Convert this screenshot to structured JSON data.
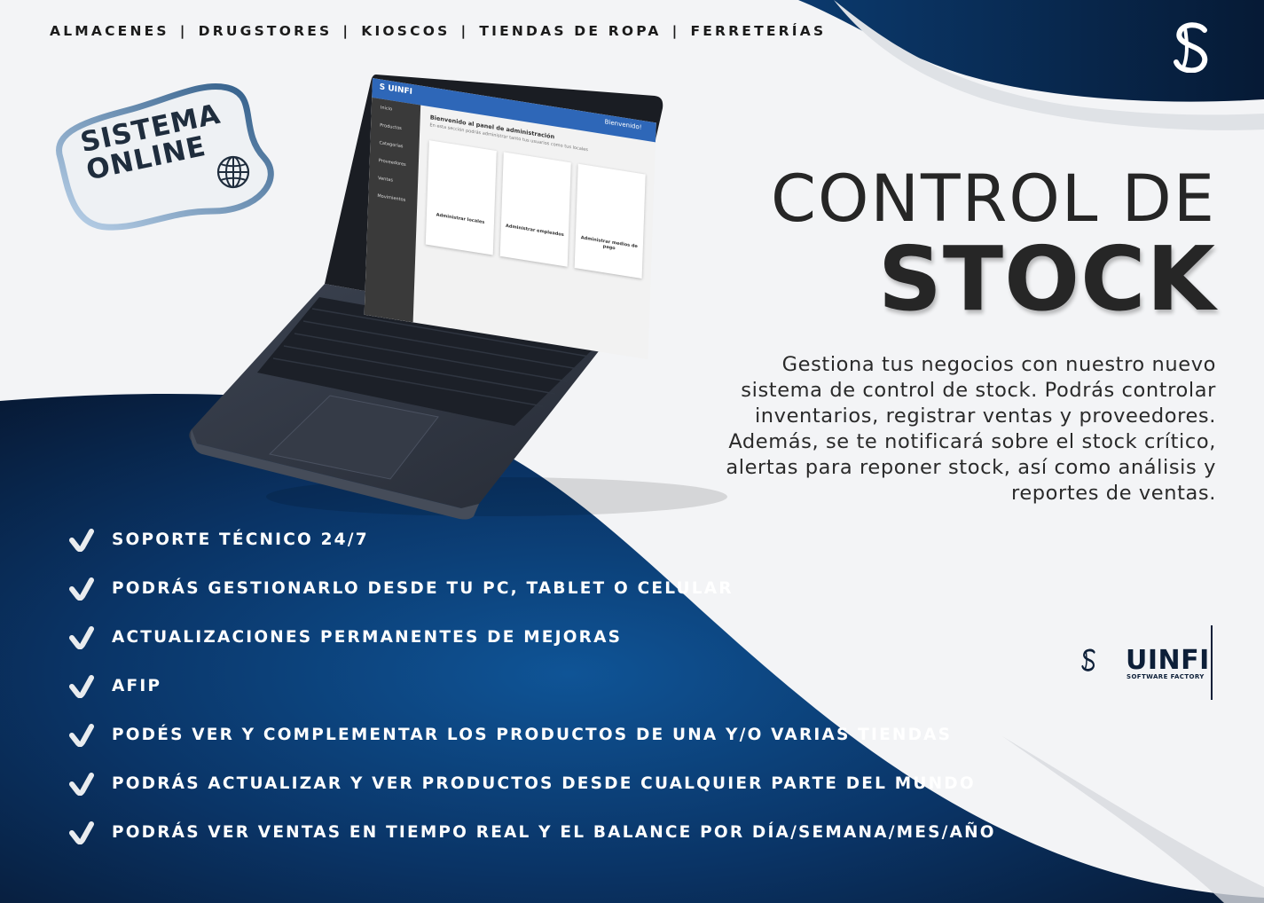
{
  "topnav": {
    "items": [
      "ALMACENES",
      "DRUGSTORES",
      "KIOSCOS",
      "TIENDAS DE ROPA",
      "FERRETERÍAS"
    ],
    "separator": "|"
  },
  "badge": {
    "line1": "SISTEMA",
    "line2": "ONLINE",
    "icon": "globe-icon"
  },
  "title": {
    "line1": "CONTROL DE",
    "line2": "STOCK"
  },
  "description": "Gestiona tus negocios con nuestro nuevo sistema de control de stock. Podrás controlar inventarios, registrar ventas y proveedores. Además, se te notificará sobre el stock crítico, alertas para reponer stock, así como análisis y reportes de ventas.",
  "features": [
    "SOPORTE TÉCNICO 24/7",
    "PODRÁS GESTIONARLO DESDE TU PC, TABLET O CELULAR",
    "ACTUALIZACIONES PERMANENTES DE MEJORAS",
    "AFIP",
    "PODÉS VER Y COMPLEMENTAR LOS PRODUCTOS DE UNA Y/O VARIAS TIENDAS",
    "PODRÁS ACTUALIZAR Y VER PRODUCTOS DESDE CUALQUIER PARTE DEL MUNDO",
    "PODRÁS VER VENTAS EN TIEMPO REAL Y EL BALANCE POR DÍA/SEMANA/MES/AÑO"
  ],
  "brand": {
    "name": "UINFI",
    "tagline": "SOFTWARE FACTORY"
  },
  "laptop_screen": {
    "app_logo": "S UINFI",
    "welcome": "Bienvenido!",
    "sidebar": [
      "Inicio",
      "Productos",
      "Categorías",
      "Proveedores",
      "Ventas",
      "Movimientos"
    ],
    "heading": "Bienvenido al panel de administración",
    "subheading": "En esta sección podrás administrar tanto tus usuarios como tus locales",
    "cards": [
      "Administrar locales",
      "Administrar empleados",
      "Administrar medios de pago"
    ]
  },
  "colors": {
    "navy": "#0b2346",
    "blue": "#0d4f8f",
    "text": "#262626",
    "light": "#f3f4f6"
  }
}
